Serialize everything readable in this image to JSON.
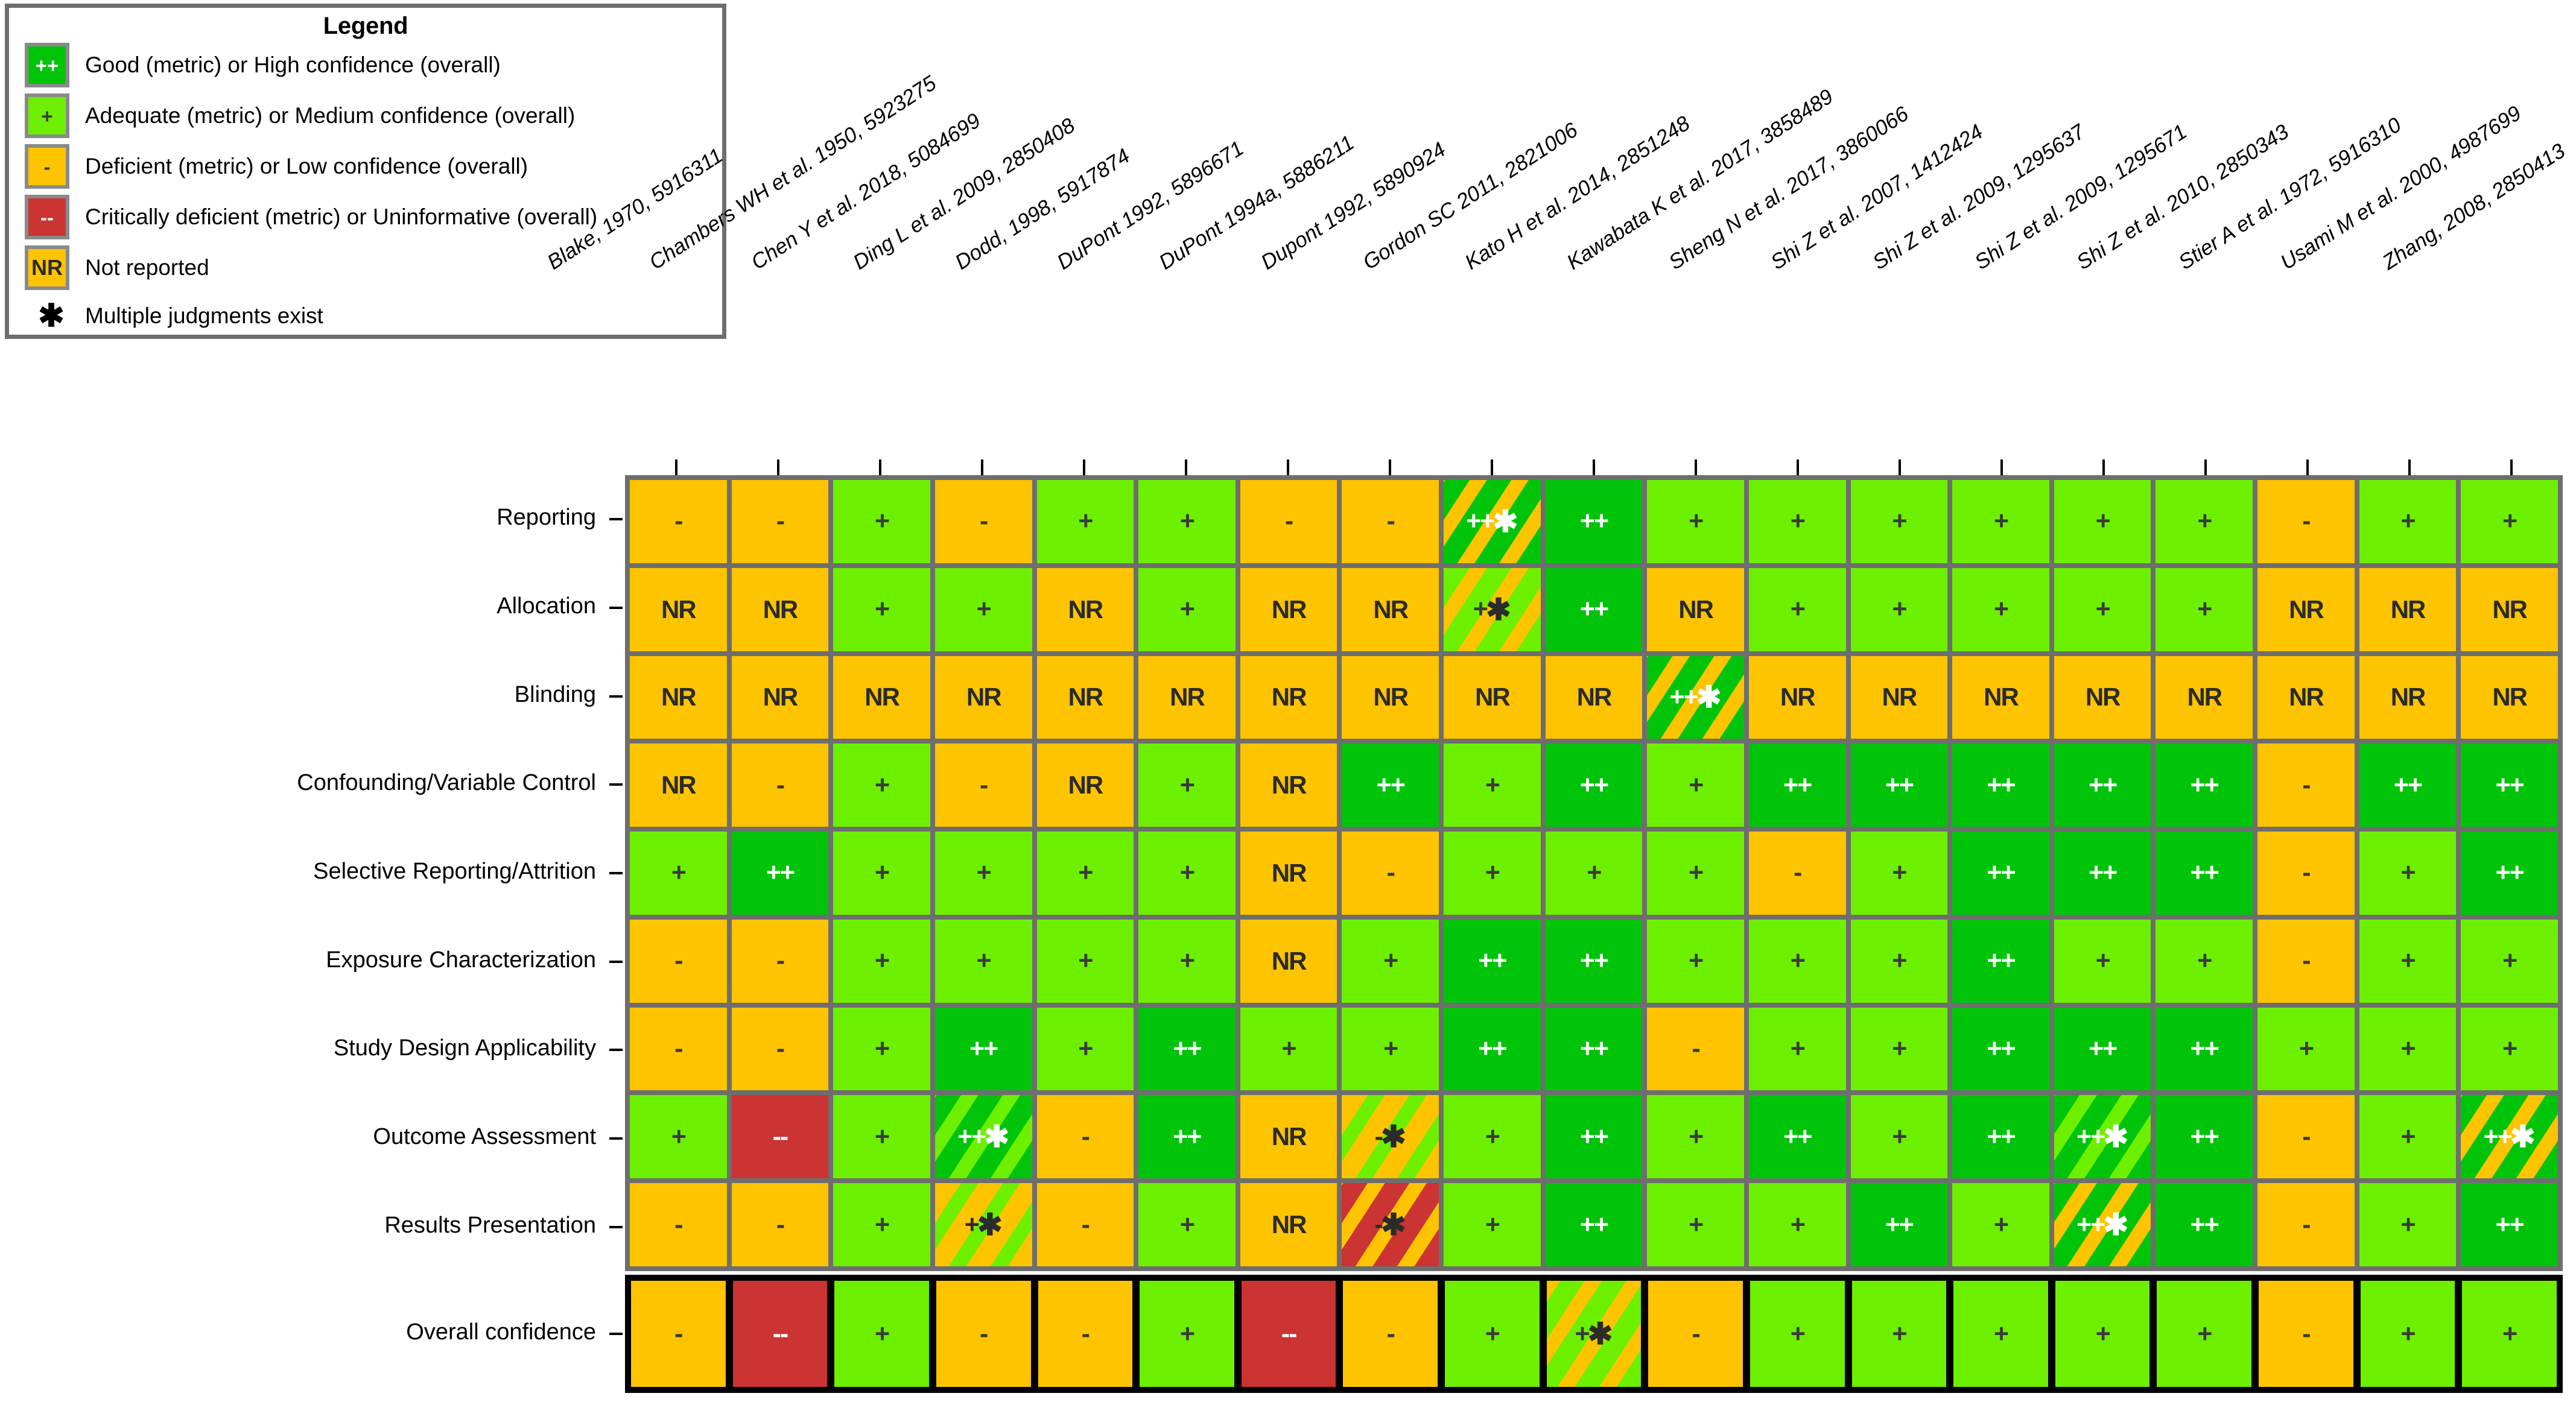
{
  "legend": {
    "title": "Legend",
    "items": [
      {
        "symbol": "++",
        "swatch": "good-green",
        "label": "Good (metric) or High confidence (overall)"
      },
      {
        "symbol": "+",
        "swatch": "adequate-green",
        "label": "Adequate (metric) or Medium confidence (overall)"
      },
      {
        "symbol": "-",
        "swatch": "deficient-orange",
        "label": "Deficient (metric) or Low confidence (overall)"
      },
      {
        "symbol": "--",
        "swatch": "critical-red",
        "label": "Critically deficient (metric) or Uninformative (overall)"
      },
      {
        "symbol": "NR",
        "swatch": "not-reported-orange",
        "label": "Not reported"
      }
    ],
    "note": {
      "symbol": "✱",
      "label": "Multiple judgments exist"
    }
  },
  "colors": {
    "good": "#00c40a",
    "adequate": "#6cf000",
    "deficient": "#ffc400",
    "critical": "#cc3333",
    "not_reported": "#ffc400",
    "grid": "#6e6e6e",
    "overall_border": "#000000"
  },
  "chart_data": {
    "type": "heatmap",
    "title": "",
    "xlabel": "",
    "ylabel": "",
    "legend_position": "top-left",
    "categories": [
      "Blake, 1970, 5916311",
      "Chambers WH et al. 1950, 5923275",
      "Chen Y et al. 2018, 5084699",
      "Ding L et al. 2009, 2850408",
      "Dodd, 1998, 5917874",
      "DuPont 1992, 5896671",
      "DuPont 1994a, 5886211",
      "Dupont 1992, 5890924",
      "Gordon SC 2011, 2821006",
      "Kato H et al. 2014, 2851248",
      "Kawabata K et al. 2017, 3858489",
      "Sheng N et al. 2017, 3860066",
      "Shi Z et al. 2007, 1412424",
      "Shi Z et al. 2009, 1295637",
      "Shi Z et al. 2009, 1295671",
      "Shi Z et al. 2010, 2850343",
      "Stier A et al. 1972, 5916310",
      "Usami M et al. 2000, 4987699",
      "Zhang, 2008, 2850413"
    ],
    "rows": [
      "Reporting",
      "Allocation",
      "Blinding",
      "Confounding/Variable Control",
      "Selective Reporting/Attrition",
      "Exposure Characterization",
      "Study Design Applicability",
      "Outcome Assessment",
      "Results Presentation",
      "Overall confidence"
    ],
    "values": [
      [
        "-",
        "-",
        "+",
        "-",
        "+",
        "+",
        "-",
        "-",
        "++*",
        "++",
        "+",
        "+",
        "+",
        "+",
        "+",
        "+",
        "-",
        "+",
        "+"
      ],
      [
        "NR",
        "NR",
        "+",
        "+",
        "NR",
        "+",
        "NR",
        "NR",
        "+*",
        "++",
        "NR",
        "+",
        "+",
        "+",
        "+",
        "+",
        "NR",
        "NR",
        "NR"
      ],
      [
        "NR",
        "NR",
        "NR",
        "NR",
        "NR",
        "NR",
        "NR",
        "NR",
        "NR",
        "NR",
        "++*",
        "NR",
        "NR",
        "NR",
        "NR",
        "NR",
        "NR",
        "NR",
        "NR"
      ],
      [
        "NR",
        "-",
        "+",
        "-",
        "NR",
        "+",
        "NR",
        "++",
        "+",
        "++",
        "+",
        "++",
        "++",
        "++",
        "++",
        "++",
        "-",
        "++",
        "++"
      ],
      [
        "+",
        "++",
        "+",
        "+",
        "+",
        "+",
        "NR",
        "-",
        "+",
        "+",
        "+",
        "-",
        "+",
        "++",
        "++",
        "++",
        "-",
        "+",
        "++"
      ],
      [
        "-",
        "-",
        "+",
        "+",
        "+",
        "+",
        "NR",
        "+",
        "++",
        "++",
        "+",
        "+",
        "+",
        "++",
        "+",
        "+",
        "-",
        "+",
        "+"
      ],
      [
        "-",
        "-",
        "+",
        "++",
        "+",
        "++",
        "+",
        "+",
        "++",
        "++",
        "-",
        "+",
        "+",
        "++",
        "++",
        "++",
        "+",
        "+",
        "+"
      ],
      [
        "+",
        "--",
        "+",
        "++*",
        "-",
        "++",
        "NR",
        "-*",
        "+",
        "++",
        "+",
        "++",
        "+",
        "++",
        "++*",
        "++",
        "-",
        "+",
        "++*"
      ],
      [
        "-",
        "-",
        "+",
        "+*",
        "-",
        "+",
        "NR",
        "-*",
        "+",
        "++",
        "+",
        "+",
        "++",
        "+",
        "++*",
        "++",
        "-",
        "+",
        "++"
      ],
      [
        "-",
        "--",
        "+",
        "-",
        "-",
        "+",
        "--",
        "-",
        "+",
        "+*",
        "-",
        "+",
        "+",
        "+",
        "+",
        "+",
        "-",
        "+",
        "+"
      ]
    ],
    "cell_styles": [
      [
        "m",
        "m",
        "p",
        "m",
        "p",
        "p",
        "m",
        "m",
        "pp-m-striped",
        "pp",
        "p",
        "p",
        "p",
        "p",
        "p",
        "p",
        "m",
        "p",
        "p"
      ],
      [
        "nr",
        "nr",
        "p",
        "p",
        "nr",
        "p",
        "nr",
        "nr",
        "p-m-striped",
        "pp",
        "nr",
        "p",
        "p",
        "p",
        "p",
        "p",
        "nr",
        "nr",
        "nr"
      ],
      [
        "nr",
        "nr",
        "nr",
        "nr",
        "nr",
        "nr",
        "nr",
        "nr",
        "nr",
        "nr",
        "pp-m-striped",
        "nr",
        "nr",
        "nr",
        "nr",
        "nr",
        "nr",
        "nr",
        "nr"
      ],
      [
        "nr",
        "m",
        "p",
        "m",
        "nr",
        "p",
        "nr",
        "pp",
        "p",
        "pp",
        "p",
        "pp",
        "pp",
        "pp",
        "pp",
        "pp",
        "m",
        "pp",
        "pp"
      ],
      [
        "p",
        "pp",
        "p",
        "p",
        "p",
        "p",
        "nr",
        "m",
        "p",
        "p",
        "p",
        "m",
        "p",
        "pp",
        "pp",
        "pp",
        "m",
        "p",
        "pp"
      ],
      [
        "m",
        "m",
        "p",
        "p",
        "p",
        "p",
        "nr",
        "p",
        "pp",
        "pp",
        "p",
        "p",
        "p",
        "pp",
        "p",
        "p",
        "m",
        "p",
        "p"
      ],
      [
        "m",
        "m",
        "p",
        "pp",
        "p",
        "pp",
        "p",
        "p",
        "pp",
        "pp",
        "m",
        "p",
        "p",
        "pp",
        "pp",
        "pp",
        "p",
        "p",
        "p"
      ],
      [
        "p",
        "mm",
        "p",
        "pp-p-striped",
        "m",
        "pp",
        "nr",
        "m-p-striped",
        "p",
        "pp",
        "p",
        "pp",
        "p",
        "pp",
        "pp-p-striped",
        "pp",
        "m",
        "p",
        "pp-m-striped"
      ],
      [
        "m",
        "m",
        "p",
        "m-p-striped",
        "m",
        "p",
        "nr",
        "m-mm-striped",
        "p",
        "pp",
        "p",
        "p",
        "pp",
        "p",
        "pp-m-striped",
        "pp",
        "m",
        "p",
        "pp"
      ],
      [
        "m",
        "mm",
        "p",
        "m",
        "m",
        "p",
        "mm",
        "m",
        "p",
        "p-m-striped",
        "m",
        "p",
        "p",
        "p",
        "p",
        "p",
        "m",
        "p",
        "p"
      ]
    ],
    "multiple_judgment_cells": [
      {
        "row": "Reporting",
        "column": "Gordon SC 2011, 2821006"
      },
      {
        "row": "Allocation",
        "column": "Gordon SC 2011, 2821006"
      },
      {
        "row": "Blinding",
        "column": "Kawabata K et al. 2017, 3858489"
      },
      {
        "row": "Outcome Assessment",
        "column": "Ding L et al. 2009, 2850408"
      },
      {
        "row": "Outcome Assessment",
        "column": "Dupont 1992, 5890924"
      },
      {
        "row": "Outcome Assessment",
        "column": "Shi Z et al. 2009, 1295671"
      },
      {
        "row": "Outcome Assessment",
        "column": "Zhang, 2008, 2850413"
      },
      {
        "row": "Results Presentation",
        "column": "Ding L et al. 2009, 2850408"
      },
      {
        "row": "Results Presentation",
        "column": "Dupont 1992, 5890924"
      },
      {
        "row": "Results Presentation",
        "column": "Shi Z et al. 2009, 1295671"
      },
      {
        "row": "Overall confidence",
        "column": "Kato H et al. 2014, 2851248"
      }
    ]
  }
}
